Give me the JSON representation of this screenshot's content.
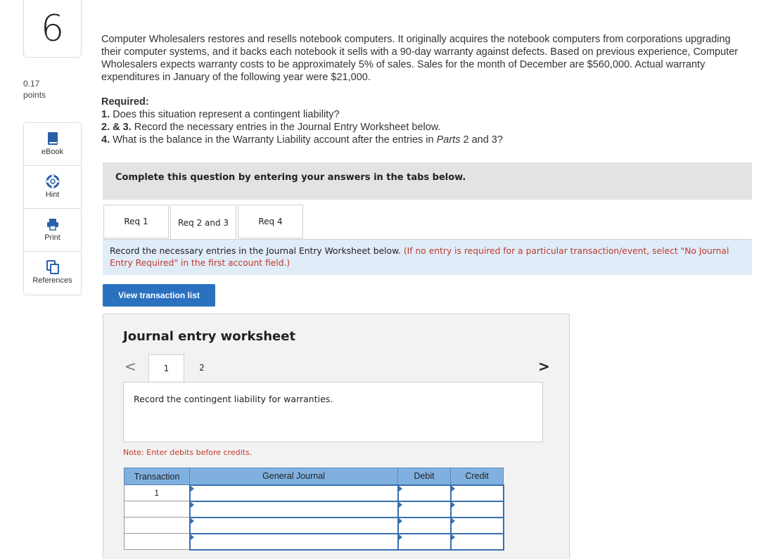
{
  "question": {
    "number": "6",
    "points": "0.17",
    "points_label": "points"
  },
  "tools": [
    {
      "label": "eBook",
      "icon": "book-icon"
    },
    {
      "label": "Hint",
      "icon": "lifebuoy-icon"
    },
    {
      "label": "Print",
      "icon": "printer-icon"
    },
    {
      "label": "References",
      "icon": "copy-pages-icon"
    }
  ],
  "intro": "Computer Wholesalers restores and resells notebook computers. It originally acquires the notebook computers from corporations upgrading their computer systems, and it backs each notebook it sells with a 90-day warranty against defects. Based on previous experience, Computer Wholesalers expects warranty costs to be approximately 5% of sales. Sales for the month of December are $560,000. Actual warranty expenditures in January of the following year were $21,000.",
  "required": {
    "heading": "Required:",
    "q1_num": "1.",
    "q1_text": " Does this situation represent a contingent liability?",
    "q2_num": "2. & 3.",
    "q2_text": " Record the necessary entries in the Journal Entry Worksheet below.",
    "q4_num": "4.",
    "q4_text_a": " What is the balance in the Warranty Liability account after the entries in ",
    "q4_parts": "Parts",
    "q4_text_b": " 2 and 3?"
  },
  "complete_bar": "Complete this question by entering your answers in the tabs below.",
  "tabs": [
    "Req 1",
    "Req 2 and 3",
    "Req 4"
  ],
  "instruction": {
    "main": "Record the necessary entries in the Journal Entry Worksheet below. ",
    "red": "(If no entry is required for a particular transaction/event, select \"No Journal Entry Required\" in the first account field.)"
  },
  "view_button": "View transaction list",
  "worksheet": {
    "title": "Journal entry worksheet",
    "nav_prev": "<",
    "nav_next": ">",
    "steps": [
      "1",
      "2"
    ],
    "description": "Record the contingent liability for warranties.",
    "note": "Note: Enter debits before credits.",
    "columns": [
      "Transaction",
      "General Journal",
      "Debit",
      "Credit"
    ],
    "rows": [
      {
        "transaction": "1",
        "account": "",
        "debit": "",
        "credit": ""
      },
      {
        "transaction": "",
        "account": "",
        "debit": "",
        "credit": ""
      },
      {
        "transaction": "",
        "account": "",
        "debit": "",
        "credit": ""
      },
      {
        "transaction": "",
        "account": "",
        "debit": "",
        "credit": ""
      }
    ]
  }
}
